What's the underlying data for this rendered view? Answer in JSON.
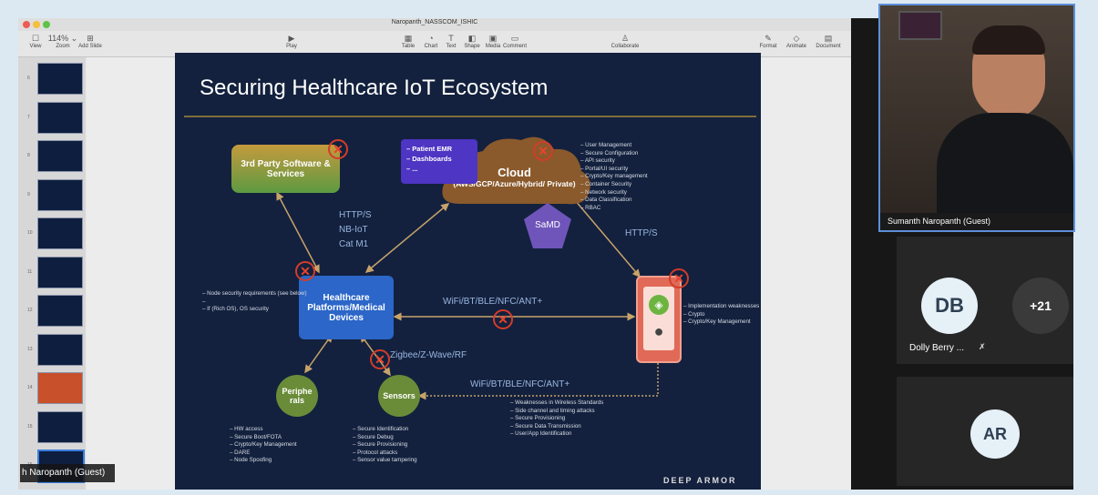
{
  "keynote": {
    "doc_title": "Naropanth_NASSCOM_ISHIC",
    "toolbar": [
      {
        "label": "View",
        "icon": "☐"
      },
      {
        "label": "Zoom",
        "icon": "114% ⌄"
      },
      {
        "label": "Add Slide",
        "icon": "⊞"
      },
      {
        "label": "Play",
        "icon": "▶"
      },
      {
        "label": "Table",
        "icon": "▦"
      },
      {
        "label": "Chart",
        "icon": "◔"
      },
      {
        "label": "Text",
        "icon": "T"
      },
      {
        "label": "Shape",
        "icon": "◧"
      },
      {
        "label": "Media",
        "icon": "▣"
      },
      {
        "label": "Comment",
        "icon": "▭"
      },
      {
        "label": "Collaborate",
        "icon": "♙"
      },
      {
        "label": "Format",
        "icon": "✎"
      },
      {
        "label": "Animate",
        "icon": "◇"
      },
      {
        "label": "Document",
        "icon": "▤"
      }
    ],
    "slide_numbers": [
      "6",
      "7",
      "8",
      "9",
      "10",
      "11",
      "12",
      "13",
      "14",
      "15",
      "16"
    ]
  },
  "slide": {
    "title": "Securing Healthcare IoT Ecosystem",
    "third_party": "3rd Party Software & Services",
    "cloud_title": "Cloud",
    "cloud_sub": "(AWS/GCP/Azure/Hybrid/ Private)",
    "emr_items": [
      "Patient EMR",
      "Dashboards",
      "..."
    ],
    "samd": "SaMD",
    "healthcare": "Healthcare Platforms/Medical Devices",
    "peripherals": "Periphe rals",
    "sensors": "Sensors",
    "proto_http": "HTTP/S",
    "proto_nbiot": "NB-IoT",
    "proto_catm1": "Cat M1",
    "proto_http2": "HTTP/S",
    "proto_wifi1": "WiFi/BT/BLE/NFC/ANT+",
    "proto_zigbee": "Zigbee/Z-Wave/RF",
    "proto_wifi2": "WiFi/BT/BLE/NFC/ANT+",
    "cloud_list": [
      "User Management",
      "Secure Configuration",
      "API security",
      "Portal/UI security",
      "Crypto/Key management",
      "Container Security",
      "Network security",
      "Data Classification",
      "RBAC"
    ],
    "node_list": [
      "Node security requirements (see below)",
      "",
      "If (Rich OS), OS security"
    ],
    "mobile_list": [
      "Implementation weaknesses",
      "Crypto",
      "Crypto/Key Management"
    ],
    "periph_list": [
      "HW access",
      "Secure Boot/FOTA",
      "Crypto/Key Management",
      "DARE",
      "Node Spoofing"
    ],
    "sensor_list": [
      "Secure Identification",
      "Secure Debug",
      "Secure Provisioning",
      "Protocol attacks",
      "Sensor value tampering"
    ],
    "wireless_list": [
      "Weaknesses in Wireless Standards",
      "Side channel and timing attacks",
      "Secure Provisioning",
      "Secure Data Transmission",
      "User/App Identification"
    ],
    "logo": "DEEP ARMOR"
  },
  "meeting": {
    "speaker_name": "Sumanth Naropanth (Guest)",
    "presenter_label": "h Naropanth (Guest)",
    "tiles": [
      {
        "initials": "DB",
        "name": "Dolly Berry ..."
      },
      {
        "initials": "+21",
        "name": ""
      },
      {
        "initials": "AR",
        "name": ""
      }
    ]
  },
  "colors": {
    "accent": "#5d8fd8",
    "muted_icon": "#e0e0e0",
    "x_mark": "#d33c2a"
  }
}
